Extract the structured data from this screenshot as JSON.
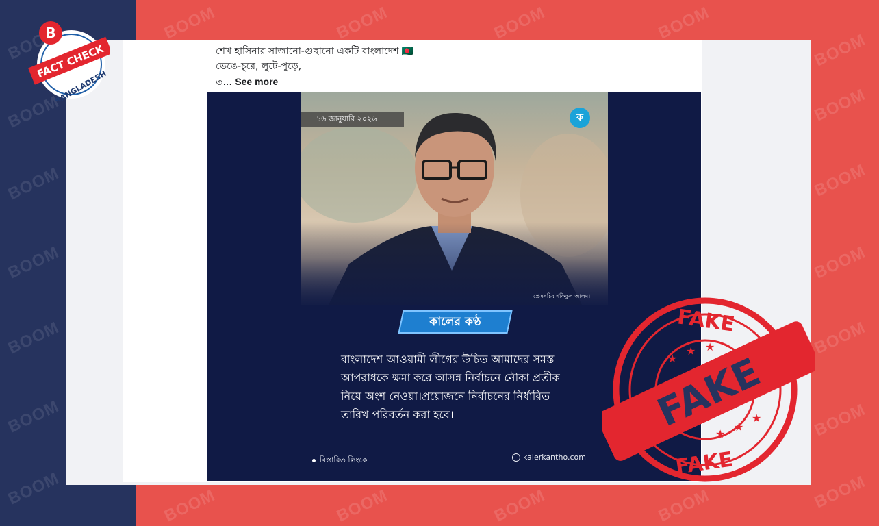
{
  "watermark": "BOOM",
  "fact_check_badge": {
    "letter": "B",
    "line1": "FACT CHECK",
    "line2": "BANGLADESH"
  },
  "post": {
    "caption_line1": "শেখ হাসিনার সাজানো-গুছানো একটি বাংলাদেশ 🇧🇩",
    "caption_line2": "ভেঙে-চুরে, লুটে-পুড়ে,",
    "caption_line3_prefix": "ত...",
    "see_more": "See more"
  },
  "news_card": {
    "date": "১৬ জানুয়ারি ২০২৬",
    "logo_letter": "ক",
    "photo_credit": "প্রেসসচিব শফিকুল আলম।",
    "brand": "কালের কণ্ঠ",
    "quote_lines": [
      "বাংলাদেশ আওয়ামী লীগের উচিত আমাদের সমস্ত",
      "আপরাধকে ক্ষমা করে আসন্ন নির্বাচনে নৌকা প্রতীক",
      "নিয়ে অংশ নেওয়া।প্রয়োজনে নির্বাচনের নির্ধারিত",
      "তারিখ পরিবর্তন করা হবে।"
    ],
    "footer_left": "বিস্তারিত লিংকে",
    "footer_right": "kalerkantho.com"
  },
  "stamp": {
    "top": "FAKE",
    "center": "FAKE",
    "bottom": "FAKE"
  },
  "colors": {
    "red_bg": "#e8524d",
    "navy": "#26335e",
    "stamp_red": "#e3262f",
    "news_bg": "#101a45",
    "brand_blue": "#1e7fd0"
  }
}
